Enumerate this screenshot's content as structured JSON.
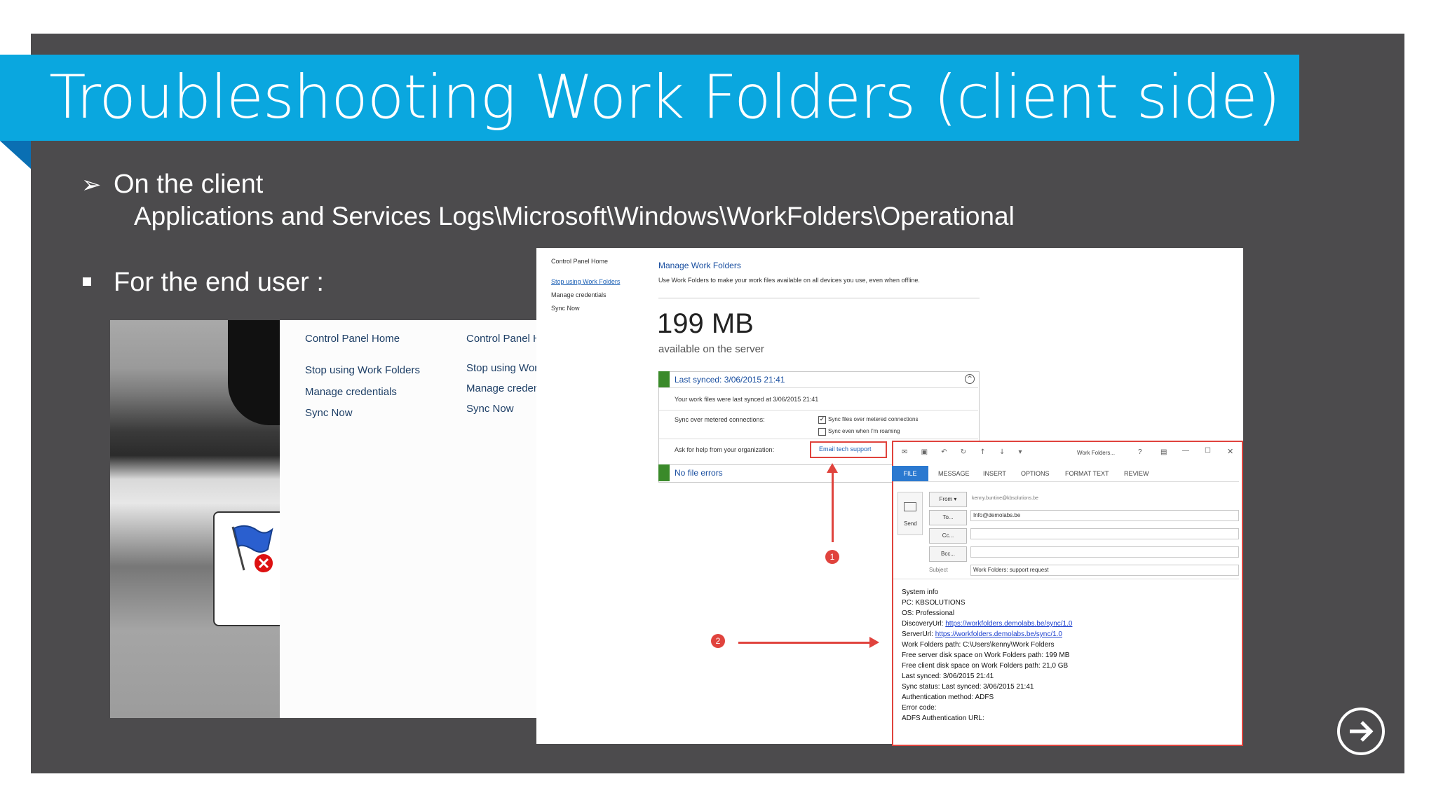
{
  "slide": {
    "title": "Troubleshooting Work Folders (client side)",
    "bullet1_label": "On the client",
    "bullet1_path": "Applications and Services Logs\\Microsoft\\Windows\\WorkFolders\\Operational",
    "bullet2_label": "For the end user :",
    "colors": {
      "background": "#4c4b4d",
      "title_bar": "#0aa7df",
      "accent_red": "#e0433d"
    }
  },
  "left_screenshot": {
    "col1": {
      "home": "Control Panel Home",
      "stop": "Stop using Work Folders",
      "creds": "Manage credentials",
      "sync": "Sync Now"
    },
    "col2": {
      "home": "Control Panel H",
      "stop": "Stop using Wor",
      "creds": "Manage credent",
      "sync": "Sync Now"
    }
  },
  "main_screenshot": {
    "sidebar": {
      "home": "Control Panel Home",
      "stop": "Stop using Work Folders",
      "creds": "Manage credentials",
      "sync": "Sync Now"
    },
    "heading": "Manage Work Folders",
    "description": "Use Work Folders to make your work files available on all devices you use, even when offline.",
    "storage_value": "199 MB",
    "storage_label": "available on the server",
    "last_synced": "Last synced: 3/06/2015 21:41",
    "last_synced_detail": "Your work files were last synced at 3/06/2015 21:41",
    "metered_label": "Sync over metered connections:",
    "metered_option1": "Sync files over metered connections",
    "metered_option2": "Sync even when I'm roaming",
    "help_label": "Ask for help from your organization:",
    "email_support": "Email tech support",
    "no_errors": "No file errors",
    "marker1": "1",
    "marker2": "2"
  },
  "email": {
    "window_title": "Work Folders...",
    "tabs": [
      "FILE",
      "MESSAGE",
      "INSERT",
      "OPTIONS",
      "FORMAT TEXT",
      "REVIEW"
    ],
    "send_label": "Send",
    "from_label": "From ▾",
    "from_value": "kenny.buntine@kbsolutions.be",
    "to_label": "To...",
    "to_value": "Info@demolabs.be",
    "cc_label": "Cc...",
    "bcc_label": "Bcc...",
    "subject_label": "Subject",
    "subject_value": "Work Folders: support request",
    "body": {
      "l1": "System info",
      "l2": "PC: KBSOLUTIONS",
      "l3": "OS: Professional",
      "l4_prefix": "DiscoveryUrl: ",
      "l4_link": "https://workfolders.demolabs.be/sync/1.0",
      "l5_prefix": "ServerUrl: ",
      "l5_link": "https://workfolders.demolabs.be/sync/1.0",
      "l6": "Work Folders path: C:\\Users\\kenny\\Work Folders",
      "l7": "Free server disk space on Work Folders path: 199 MB",
      "l8": "Free client disk space on Work Folders path: 21,0 GB",
      "l9": "Last synced: 3/06/2015 21:41",
      "l10": "Sync status: Last synced: 3/06/2015 21:41",
      "l11": "Authentication method: ADFS",
      "l12": "Error code:",
      "l13": "ADFS Authentication URL:"
    }
  },
  "nav": {
    "next_icon": "arrow-right-circle-icon"
  }
}
